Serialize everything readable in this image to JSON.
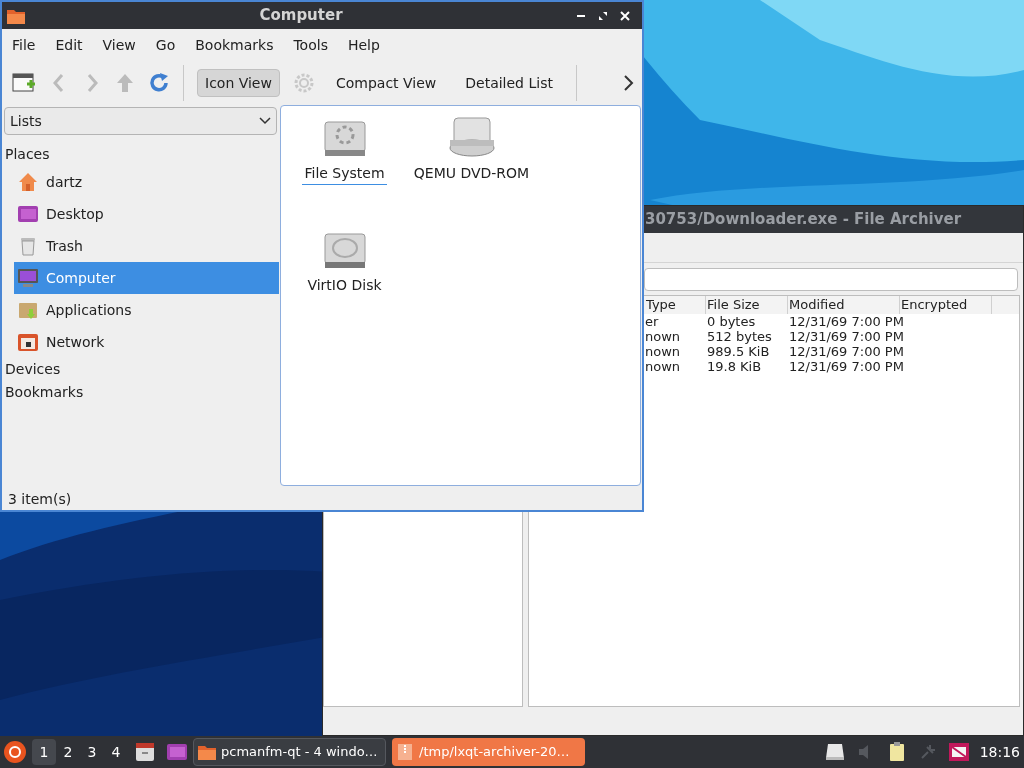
{
  "file_manager": {
    "title": "Computer",
    "menu": [
      "File",
      "Edit",
      "View",
      "Go",
      "Bookmarks",
      "Tools",
      "Help"
    ],
    "views": [
      {
        "label": "Icon View",
        "selected": true
      },
      {
        "label": "Compact View",
        "selected": false
      },
      {
        "label": "Detailed List",
        "selected": false
      }
    ],
    "panel_selector": "Lists",
    "sections": [
      {
        "label": "Places",
        "items": [
          {
            "label": "dartz",
            "kind": "home",
            "selected": false
          },
          {
            "label": "Desktop",
            "kind": "desktop",
            "selected": false
          },
          {
            "label": "Trash",
            "kind": "trash",
            "selected": false
          },
          {
            "label": "Computer",
            "kind": "computer",
            "selected": true
          },
          {
            "label": "Applications",
            "kind": "applications",
            "selected": false
          },
          {
            "label": "Network",
            "kind": "network",
            "selected": false
          }
        ]
      },
      {
        "label": "Devices"
      },
      {
        "label": "Bookmarks"
      }
    ],
    "files": [
      {
        "label": "File System",
        "kind": "drive",
        "focused": true
      },
      {
        "label": "QEMU DVD-ROM",
        "kind": "optical",
        "focused": false
      },
      {
        "label": "VirtIO Disk",
        "kind": "disk",
        "focused": false
      }
    ],
    "status": "3 item(s)"
  },
  "archiver": {
    "title": "30753/Downloader.exe - File Archiver",
    "columns": [
      "Type",
      "File Size",
      "Modified",
      "Encrypted"
    ],
    "rows": [
      {
        "type": "er",
        "size": "0 bytes",
        "modified": "12/31/69 7:00 PM"
      },
      {
        "type": "nown",
        "size": "512 bytes",
        "modified": "12/31/69 7:00 PM"
      },
      {
        "type": "nown",
        "size": "989.5 KiB",
        "modified": "12/31/69 7:00 PM"
      },
      {
        "type": "nown",
        "size": "19.8 KiB",
        "modified": "12/31/69 7:00 PM"
      }
    ]
  },
  "taskbar": {
    "workspaces": [
      {
        "label": "1",
        "selected": true
      },
      {
        "label": "2",
        "selected": false
      },
      {
        "label": "3",
        "selected": false
      },
      {
        "label": "4",
        "selected": false
      }
    ],
    "tasks": [
      {
        "label": "pcmanfm-qt - 4 windo…",
        "selected": false
      },
      {
        "label": "/tmp/lxqt-archiver-20…",
        "selected": true
      }
    ],
    "clock": "18:16"
  }
}
